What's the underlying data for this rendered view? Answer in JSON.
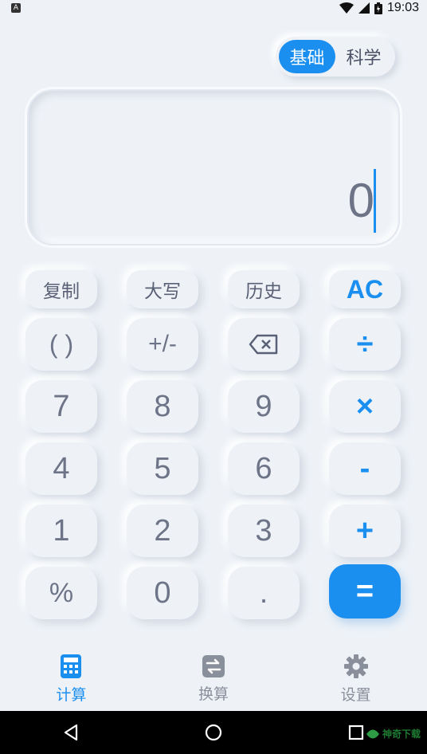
{
  "status_bar": {
    "time": "19:03",
    "app_icon_letter": "A"
  },
  "mode_toggle": {
    "basic": "基础",
    "scientific": "科学",
    "active": "basic"
  },
  "display": {
    "value": "0"
  },
  "function_row": {
    "copy": "复制",
    "uppercase": "大写",
    "history": "历史",
    "clear": "AC"
  },
  "keys": {
    "parens": "( )",
    "sign": "+/-",
    "divide": "÷",
    "seven": "7",
    "eight": "8",
    "nine": "9",
    "multiply": "×",
    "four": "4",
    "five": "5",
    "six": "6",
    "minus": "-",
    "one": "1",
    "two": "2",
    "three": "3",
    "plus": "+",
    "percent": "%",
    "zero": "0",
    "dot": ".",
    "equals": "="
  },
  "bottom_nav": {
    "calc": "计算",
    "convert": "换算",
    "settings": "设置",
    "active": "calc"
  },
  "watermark": {
    "text": "神奇下载"
  },
  "colors": {
    "accent": "#1a8ff0",
    "background": "#eef2f7",
    "key_text": "#6e7488"
  }
}
